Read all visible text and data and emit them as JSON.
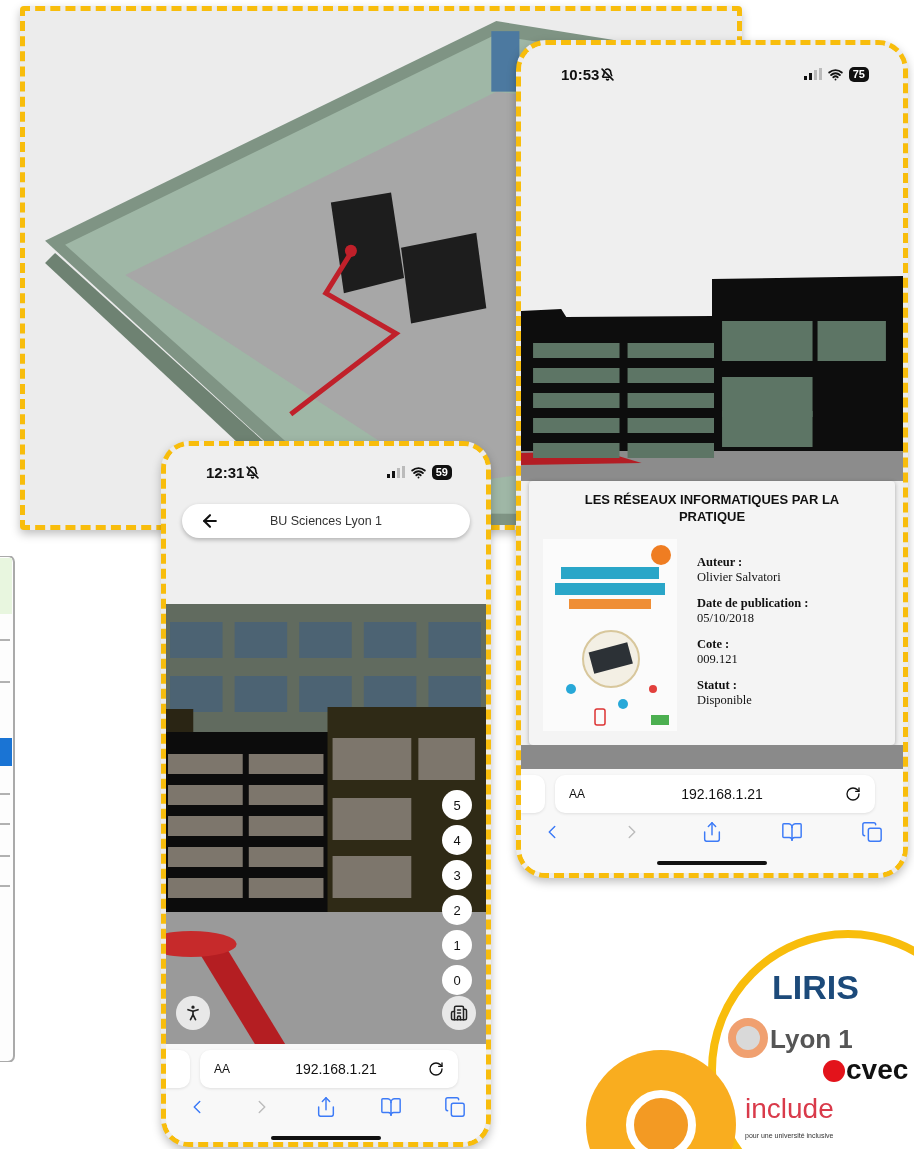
{
  "detail_phone": {
    "status_bar": {
      "time": "10:53",
      "battery": "75"
    },
    "book_card": {
      "title": "LES RÉSEAUX INFORMATIQUES PAR LA PRATIQUE",
      "fields": [
        {
          "label": "Auteur :",
          "value": "Olivier Salvatori"
        },
        {
          "label": "Date de publication :",
          "value": "05/10/2018"
        },
        {
          "label": "Cote :",
          "value": "009.121"
        },
        {
          "label": "Statut :",
          "value": "Disponible"
        }
      ]
    },
    "address_bar": {
      "text_size": "AA",
      "url": "192.168.1.21"
    },
    "toolbar": [
      {
        "kind": "back",
        "disabled": false
      },
      {
        "kind": "forward",
        "disabled": true
      },
      {
        "kind": "share",
        "disabled": false
      },
      {
        "kind": "bookmarks",
        "disabled": false
      },
      {
        "kind": "tabs",
        "disabled": false
      }
    ]
  },
  "map_phone": {
    "status_bar": {
      "time": "12:31",
      "battery": "59"
    },
    "header": {
      "title": "BU Sciences Lyon 1"
    },
    "floors": [
      "5",
      "4",
      "3",
      "2",
      "1",
      "0"
    ],
    "address_bar": {
      "text_size": "AA",
      "url": "192.168.1.21"
    },
    "toolbar": [
      {
        "kind": "back",
        "disabled": false
      },
      {
        "kind": "forward",
        "disabled": true
      },
      {
        "kind": "share",
        "disabled": false
      },
      {
        "kind": "bookmarks",
        "disabled": false
      },
      {
        "kind": "tabs",
        "disabled": false
      }
    ]
  },
  "logos": {
    "liris": "LIRIS",
    "lyon": "Lyon 1",
    "cvec": "cvec",
    "include": "include",
    "include_caption": "pour une université inclusive"
  }
}
